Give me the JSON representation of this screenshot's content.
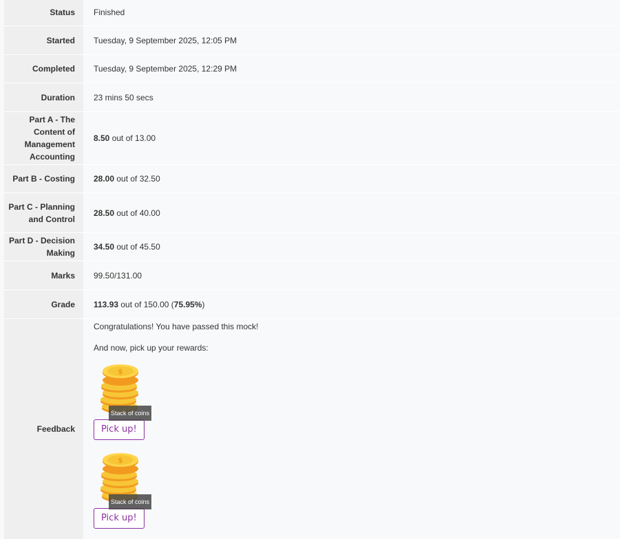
{
  "summary": {
    "status": {
      "label": "Status",
      "value": "Finished"
    },
    "started": {
      "label": "Started",
      "value": "Tuesday, 9 September 2025, 12:05 PM"
    },
    "completed": {
      "label": "Completed",
      "value": "Tuesday, 9 September 2025, 12:29 PM"
    },
    "duration": {
      "label": "Duration",
      "value": "23 mins 50 secs"
    },
    "part_a": {
      "label": "Part A - The Content of Management Accounting",
      "score": "8.50",
      "out_of": " out of 13.00"
    },
    "part_b": {
      "label": "Part B - Costing",
      "score": "28.00",
      "out_of": " out of 32.50"
    },
    "part_c": {
      "label": "Part C - Planning and Control",
      "score": "28.50",
      "out_of": " out of 40.00"
    },
    "part_d": {
      "label": "Part D - Decision Making",
      "score": "34.50",
      "out_of": " out of 45.50"
    },
    "marks": {
      "label": "Marks",
      "value": "99.50/131.00"
    },
    "grade": {
      "label": "Grade",
      "score": "113.93",
      "out_of": " out of 150.00 (",
      "percent": "75.95%",
      "close": ")"
    },
    "feedback": {
      "label": "Feedback",
      "line1": "Congratulations! You have passed this mock!",
      "line2": "And now, pick up your rewards:",
      "rewards": [
        {
          "tooltip": "Stack of coins",
          "button": "Pick up!"
        },
        {
          "tooltip": "Stack of coins",
          "button": "Pick up!"
        }
      ]
    }
  },
  "colors": {
    "accent": "#8b2fa0",
    "label_bg": "#efefef",
    "coin_gold": "#f7c637",
    "coin_orange": "#f29a1f"
  },
  "icons": [
    "coin-stack-icon"
  ]
}
